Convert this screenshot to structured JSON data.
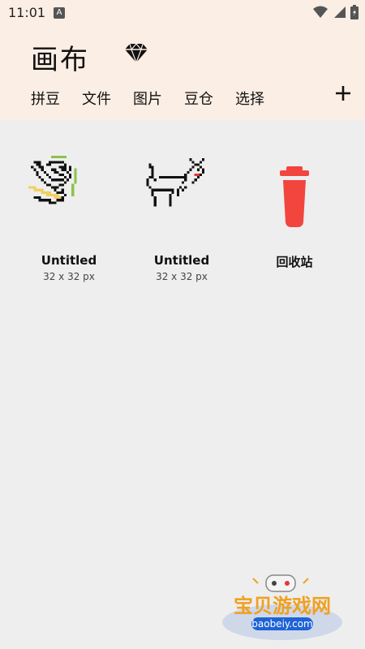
{
  "status": {
    "time": "11:01",
    "a_badge": "A"
  },
  "header": {
    "title": "画布"
  },
  "tabs": [
    {
      "label": "拼豆"
    },
    {
      "label": "文件"
    },
    {
      "label": "图片"
    },
    {
      "label": "豆仓"
    },
    {
      "label": "选择"
    }
  ],
  "add_label": "+",
  "canvases": [
    {
      "title": "Untitled",
      "size": "32 x 32 px"
    },
    {
      "title": "Untitled",
      "size": "32 x 32 px"
    }
  ],
  "trash": {
    "label": "回收站"
  },
  "watermark": {
    "title": "宝贝游戏网",
    "url": "baobeiy.com"
  },
  "colors": {
    "header_bg": "#fbeee4",
    "body_bg": "#eeeeee",
    "trash_red": "#f2453d"
  }
}
